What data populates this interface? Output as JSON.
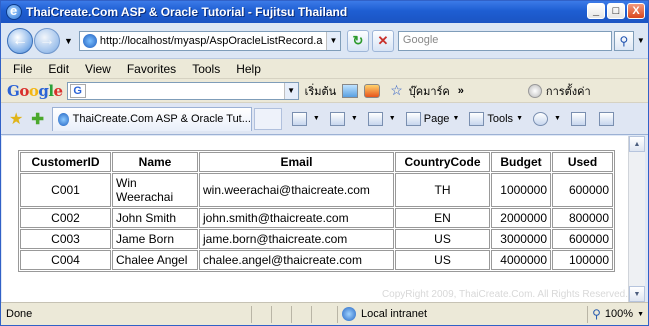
{
  "window": {
    "title": "ThaiCreate.Com ASP & Oracle Tutorial - Fujitsu Thailand",
    "controls": {
      "minimize": "_",
      "maximize": "□",
      "close": "X"
    }
  },
  "address_bar": {
    "url": "http://localhost/myasp/AspOracleListRecord.a",
    "search_placeholder": "Google"
  },
  "menu": [
    "File",
    "Edit",
    "View",
    "Favorites",
    "Tools",
    "Help"
  ],
  "google_toolbar": {
    "logo": "Google",
    "search_letter": "G",
    "go_label": "เริ่มต้น",
    "bookmarks_label": "บุ๊คมาร์ค",
    "more": "»",
    "settings_label": "การตั้งค่า"
  },
  "tabs": [
    {
      "label": "ThaiCreate.Com ASP & Oracle Tut..."
    }
  ],
  "command_bar": {
    "page_label": "Page",
    "tools_label": "Tools"
  },
  "table": {
    "headers": [
      "CustomerID",
      "Name",
      "Email",
      "CountryCode",
      "Budget",
      "Used"
    ],
    "rows": [
      [
        "C001",
        "Win Weerachai",
        "win.weerachai@thaicreate.com",
        "TH",
        "1000000",
        "600000"
      ],
      [
        "C002",
        "John Smith",
        "john.smith@thaicreate.com",
        "EN",
        "2000000",
        "800000"
      ],
      [
        "C003",
        "Jame Born",
        "jame.born@thaicreate.com",
        "US",
        "3000000",
        "600000"
      ],
      [
        "C004",
        "Chalee Angel",
        "chalee.angel@thaicreate.com",
        "US",
        "4000000",
        "100000"
      ]
    ]
  },
  "watermark": "CopyRight 2009, ThaiCreate.Com. All Rights Reserved.",
  "status": {
    "text": "Done",
    "zone": "Local intranet",
    "zoom": "100%"
  },
  "colors": {
    "titlebar": "#1e5ed2",
    "window_border": "#3161c7"
  }
}
